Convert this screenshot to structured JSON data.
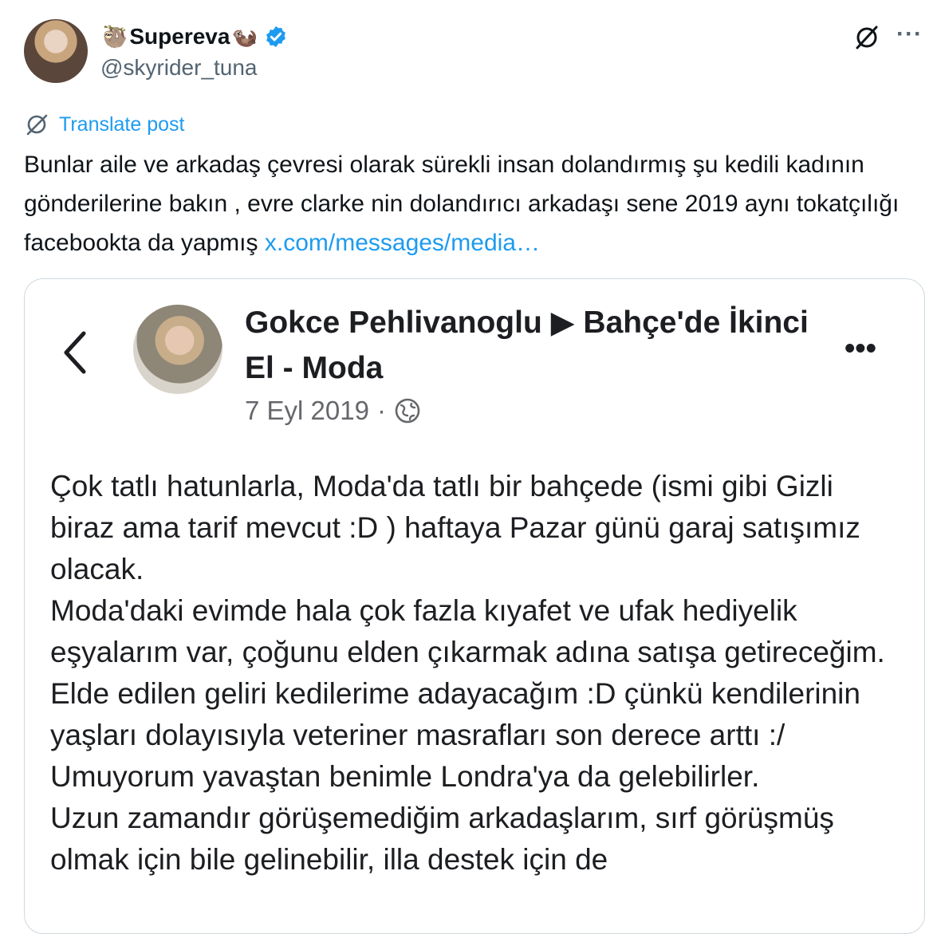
{
  "author": {
    "display_name": "Supereva",
    "emoji_left": "🦥",
    "emoji_right": "🦦",
    "handle": "@skyrider_tuna",
    "verified_color": "#1d9bf0"
  },
  "actions": {
    "grok_icon": "grok-icon",
    "more": "···"
  },
  "translate": {
    "label": "Translate post"
  },
  "post": {
    "text": "Bunlar aile ve arkadaş çevresi olarak sürekli insan dolandırmış şu kedili kadının gönderilerine bakın , evre clarke nin dolandırıcı arkadaşı sene 2019 aynı tokatçılığı facebookta da yapmış ",
    "link": "x.com/messages/media…"
  },
  "media": {
    "fb_title": "Gokce Pehlivanoglu ▶ Bahçe'de İkinci El - Moda",
    "fb_date": "7 Eyl 2019",
    "fb_dot": "·",
    "fb_more": "•••",
    "fb_body": "Çok tatlı hatunlarla, Moda'da tatlı bir bahçede (ismi gibi Gizli biraz ama tarif mevcut :D ) haftaya Pazar günü garaj satışımız olacak.\nModa'daki evimde hala çok fazla kıyafet ve ufak hediyelik eşyalarım var, çoğunu elden çıkarmak adına satışa getireceğim. Elde edilen geliri kedilerime adayacağım :D çünkü kendilerinin yaşları dolayısıyla veteriner masrafları son derece arttı :/ Umuyorum yavaştan benimle Londra'ya da gelebilirler.\nUzun zamandır görüşemediğim arkadaşlarım, sırf görüşmüş olmak için bile gelinebilir, illa destek için de"
  }
}
